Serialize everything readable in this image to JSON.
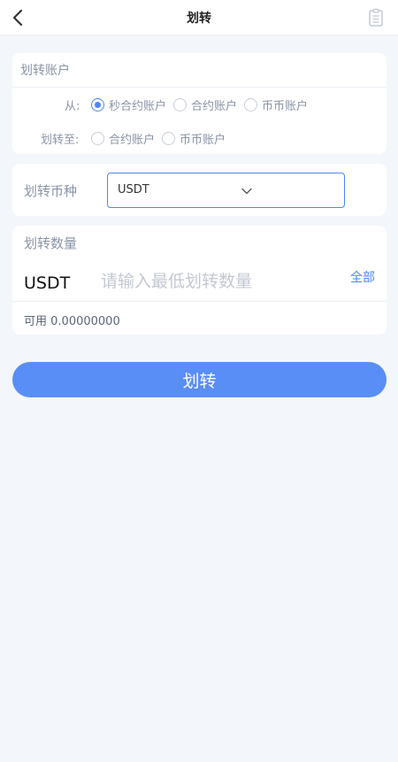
{
  "header": {
    "title": "划转",
    "back_icon": "chevron-left-icon",
    "record_icon": "clipboard-icon"
  },
  "account": {
    "title": "划转账户",
    "from_label": "从:",
    "to_label": "划转至:",
    "from_options": [
      {
        "label": "秒合约账户",
        "checked": true
      },
      {
        "label": "合约账户",
        "checked": false
      },
      {
        "label": "币币账户",
        "checked": false
      }
    ],
    "to_options": [
      {
        "label": "合约账户",
        "checked": false
      },
      {
        "label": "币币账户",
        "checked": false
      }
    ]
  },
  "currency": {
    "label": "划转币种",
    "selected": "USDT"
  },
  "amount": {
    "title": "划转数量",
    "unit": "USDT",
    "placeholder": "请输入最低划转数量",
    "value": "",
    "all_label": "全部",
    "available_label": "可用",
    "available_value": "0.00000000"
  },
  "submit_label": "划转",
  "colors": {
    "accent": "#4f86f7",
    "button": "#5a8ef7",
    "background": "#f3f6fa"
  }
}
